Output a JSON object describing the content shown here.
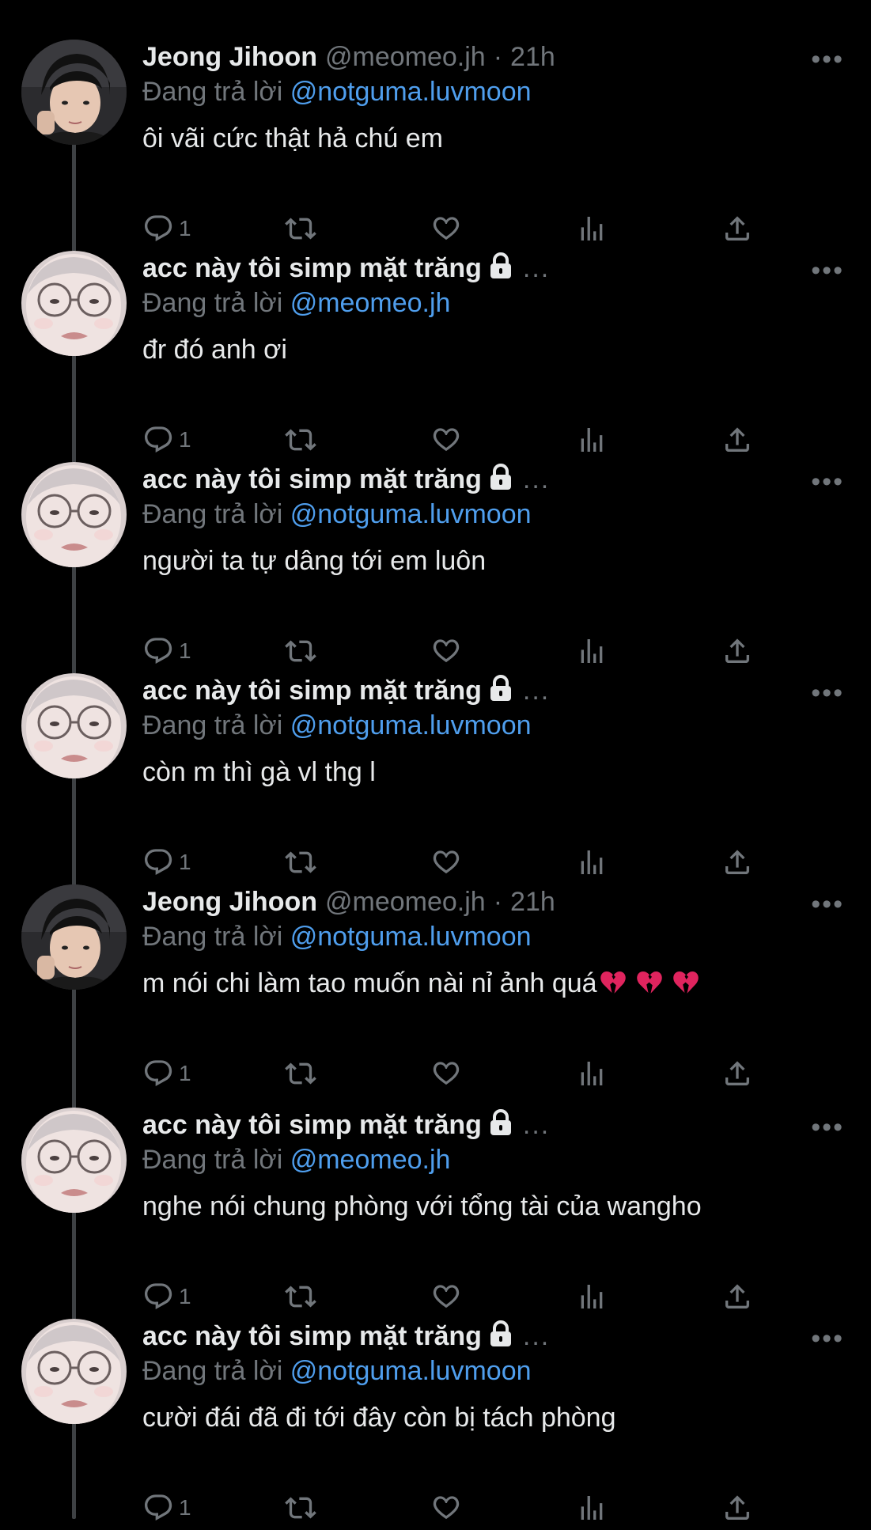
{
  "tweets": [
    {
      "name": "Jeong Jihoon",
      "handle": "@meomeo.jh",
      "time": "21h",
      "locked": false,
      "reply_prefix": "Đang trả lời",
      "reply_to": "@notguma.luvmoon",
      "text": "ôi vãi cức thật hả chú em",
      "reply_count": "1",
      "avatar": "jihoon",
      "hearts": 0
    },
    {
      "name": "acc này tôi simp mặt trăng",
      "handle": "",
      "time": "",
      "locked": true,
      "reply_prefix": "Đang trả lời",
      "reply_to": "@meomeo.jh",
      "text": "đr đó anh ơi",
      "reply_count": "1",
      "avatar": "moon",
      "hearts": 0
    },
    {
      "name": "acc này tôi simp mặt trăng",
      "handle": "",
      "time": "",
      "locked": true,
      "reply_prefix": "Đang trả lời",
      "reply_to": "@notguma.luvmoon",
      "text": "người ta tự dâng tới em luôn",
      "reply_count": "1",
      "avatar": "moon",
      "hearts": 0
    },
    {
      "name": "acc này tôi simp mặt trăng",
      "handle": "",
      "time": "",
      "locked": true,
      "reply_prefix": "Đang trả lời",
      "reply_to": "@notguma.luvmoon",
      "text": "còn m thì gà vl thg l",
      "reply_count": "1",
      "avatar": "moon",
      "hearts": 0
    },
    {
      "name": "Jeong Jihoon",
      "handle": "@meomeo.jh",
      "time": "21h",
      "locked": false,
      "reply_prefix": "Đang trả lời",
      "reply_to": "@notguma.luvmoon",
      "text": "m nói chi làm tao muốn nài nỉ ảnh quá",
      "reply_count": "1",
      "avatar": "jihoon",
      "hearts": 3
    },
    {
      "name": "acc này tôi simp mặt trăng",
      "handle": "",
      "time": "",
      "locked": true,
      "reply_prefix": "Đang trả lời",
      "reply_to": "@meomeo.jh",
      "text": "nghe nói chung phòng với tổng tài của wangho",
      "reply_count": "1",
      "avatar": "moon",
      "hearts": 0
    },
    {
      "name": "acc này tôi simp mặt trăng",
      "handle": "",
      "time": "",
      "locked": true,
      "reply_prefix": "Đang trả lời",
      "reply_to": "@notguma.luvmoon",
      "text": "cười đái đã đi tới đây còn bị tách phòng",
      "reply_count": "1",
      "avatar": "moon",
      "hearts": 0
    }
  ],
  "ui": {
    "separator": "·",
    "more": "•••",
    "trailing_ellipsis": "..."
  },
  "colors": {
    "background": "#000000",
    "text": "#e7e9ea",
    "muted": "#71767b",
    "link": "#4f9eed",
    "thread_line": "#3e4144",
    "broken_heart": "#e0245e"
  }
}
